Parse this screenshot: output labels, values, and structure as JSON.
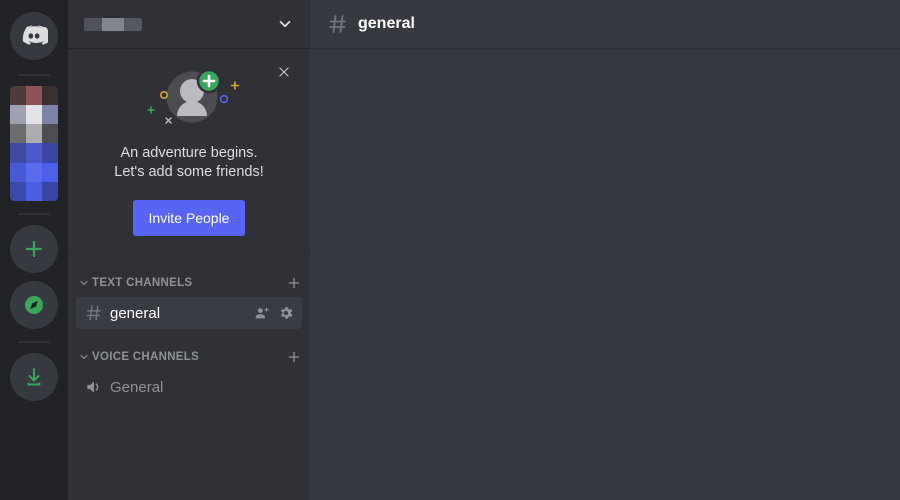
{
  "theme": {
    "rail_bg": "#202225",
    "sidebar_bg": "#2f3136",
    "main_bg": "#36393f",
    "accent_blurple": "#5865F2",
    "accent_green": "#3BA55D",
    "text_muted": "#8e9297",
    "text_normal": "#dcddde",
    "text_active": "#ffffff",
    "channel_active_bg": "#393c43"
  },
  "rail": {
    "home_icon": "discord-logo-icon",
    "server_icon": {
      "name": "server-icon-blurred",
      "redacted": true,
      "selected": true
    },
    "actions": [
      {
        "name": "add-server-button",
        "icon": "plus-icon",
        "label": "Add a Server"
      },
      {
        "name": "explore-servers-button",
        "icon": "compass-icon",
        "label": "Explore Public Servers"
      },
      {
        "name": "download-apps-button",
        "icon": "download-icon",
        "label": "Download Apps"
      }
    ]
  },
  "sidebar": {
    "server_name": {
      "value": "",
      "redacted": true
    },
    "dropdown_icon": "chevron-down-icon",
    "invite_card": {
      "close_icon": "close-icon",
      "illustration": "add-friend-avatar-illustration",
      "line1": "An adventure begins.",
      "line2": "Let's add some friends!",
      "button_label": "Invite People"
    },
    "categories": [
      {
        "name": "TEXT CHANNELS",
        "collapse_icon": "chevron-down-icon",
        "add_icon": "plus-icon",
        "channels": [
          {
            "name": "general",
            "type": "text",
            "icon": "hash-icon",
            "active": true,
            "actions": [
              {
                "name": "create-invite-icon",
                "icon": "person-add-icon"
              },
              {
                "name": "edit-channel-icon",
                "icon": "gear-icon"
              }
            ]
          }
        ]
      },
      {
        "name": "VOICE CHANNELS",
        "collapse_icon": "chevron-down-icon",
        "add_icon": "plus-icon",
        "channels": [
          {
            "name": "General",
            "type": "voice",
            "icon": "speaker-icon",
            "active": false,
            "actions": []
          }
        ]
      }
    ]
  },
  "main": {
    "channel_icon": "hash-icon",
    "channel_title": "general",
    "messages": []
  }
}
